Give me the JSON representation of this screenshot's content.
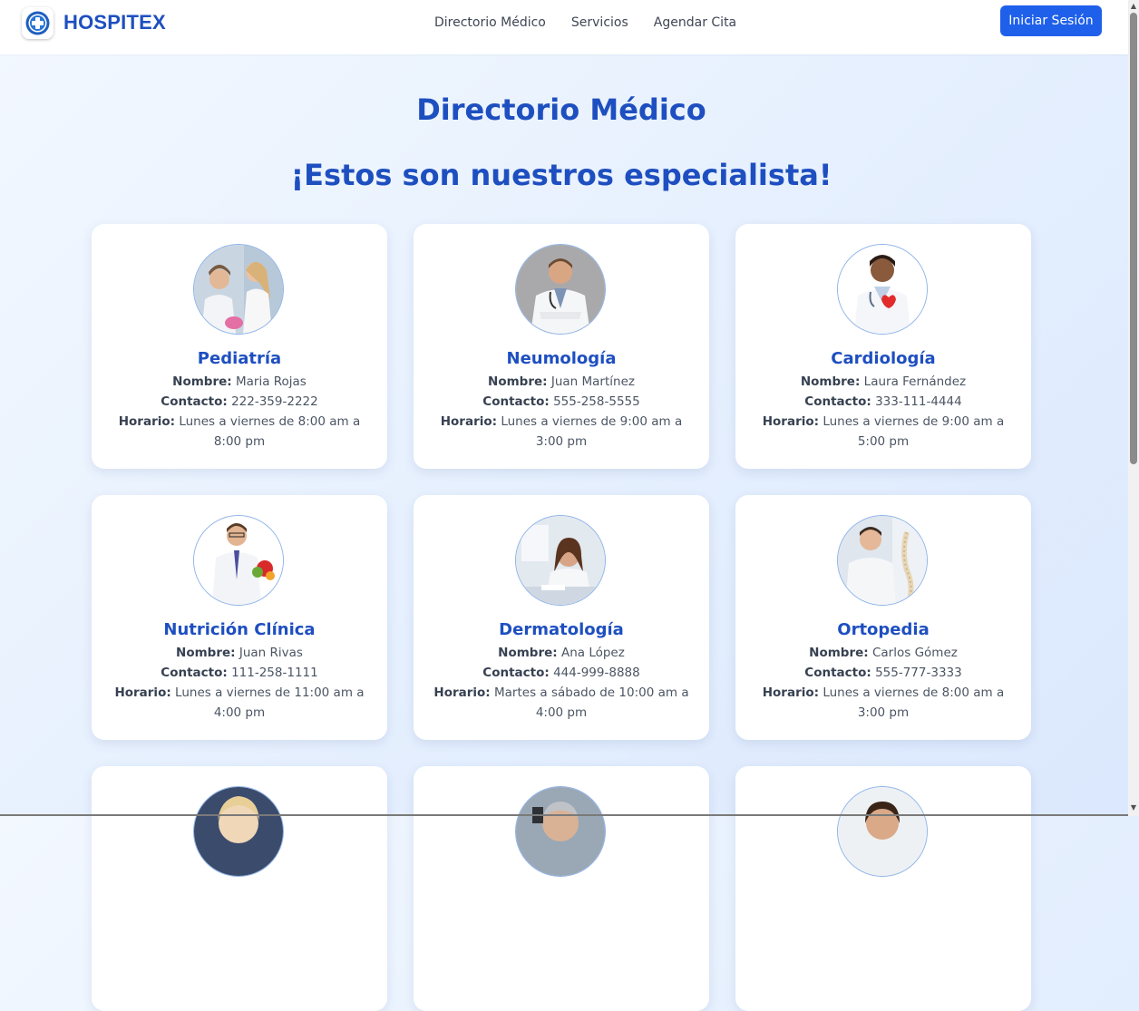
{
  "brand": {
    "name": "HOSPITEX"
  },
  "nav": {
    "links": [
      "Directorio Médico",
      "Servicios",
      "Agendar Cita"
    ],
    "login": "Iniciar Sesión"
  },
  "page": {
    "title": "Directorio Médico",
    "subtitle": "¡Estos son nuestros especialista!"
  },
  "labels": {
    "name": "Nombre:",
    "contact": "Contacto:",
    "schedule": "Horario:"
  },
  "doctors": [
    {
      "specialty": "Pediatría",
      "name": "Maria Rojas",
      "contact": "222-359-2222",
      "schedule": "Lunes a viernes de 8:00 am a 8:00 pm"
    },
    {
      "specialty": "Neumología",
      "name": "Juan Martínez",
      "contact": "555-258-5555",
      "schedule": "Lunes a viernes de 9:00 am a 3:00 pm"
    },
    {
      "specialty": "Cardiología",
      "name": "Laura Fernández",
      "contact": "333-111-4444",
      "schedule": "Lunes a viernes de 9:00 am a 5:00 pm"
    },
    {
      "specialty": "Nutrición Clínica",
      "name": "Juan Rivas",
      "contact": "111-258-1111",
      "schedule": "Lunes a viernes de 11:00 am a 4:00 pm"
    },
    {
      "specialty": "Dermatología",
      "name": "Ana López",
      "contact": "444-999-8888",
      "schedule": "Martes a sábado de 10:00 am a 4:00 pm"
    },
    {
      "specialty": "Ortopedia",
      "name": "Carlos Gómez",
      "contact": "555-777-3333",
      "schedule": "Lunes a viernes de 8:00 am a 3:00 pm"
    }
  ],
  "colors": {
    "brand": "#1e4fc0",
    "button": "#1f60eb"
  },
  "icons": {
    "logo": "medical-cross-icon"
  }
}
